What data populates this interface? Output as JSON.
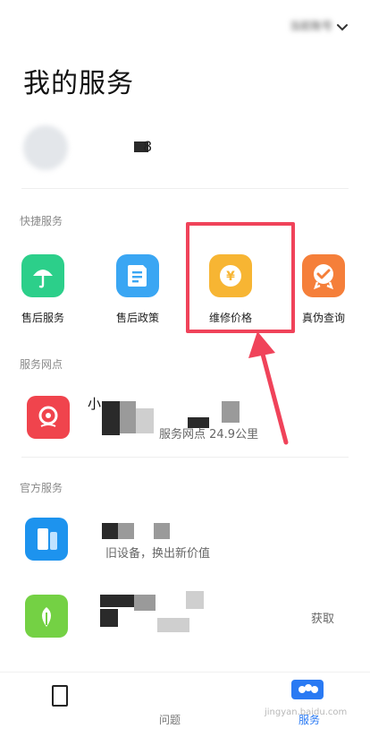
{
  "header": {
    "account_name": "当前账号",
    "title": "我的服务"
  },
  "user": {
    "name_fragment": "8"
  },
  "quick_services": {
    "label": "快捷服务",
    "items": [
      {
        "label": "售后服务",
        "color": "#2ccf8a",
        "icon": "umbrella-icon"
      },
      {
        "label": "售后政策",
        "color": "#3aa6f3",
        "icon": "document-icon"
      },
      {
        "label": "维修价格",
        "color": "#f7b533",
        "icon": "yen-coin-icon"
      },
      {
        "label": "真伪查询",
        "color": "#f57f3a",
        "icon": "badge-check-icon"
      }
    ]
  },
  "service_points": {
    "label": "服务网点",
    "item": {
      "title_fragment": "小",
      "distance_text": "服务网点 24.9公里",
      "color": "#f0444d"
    }
  },
  "official_services": {
    "label": "官方服务",
    "items": [
      {
        "subtitle": "旧设备，换出新价值",
        "color": "#1d93ee"
      },
      {
        "right_text": "获取",
        "color": "#74d144"
      }
    ]
  },
  "bottom_nav": {
    "items": [
      {
        "label": "问题",
        "active": false
      },
      {
        "label": "服务",
        "active": true
      }
    ],
    "accent": "#2a7af3"
  },
  "annotation": {
    "highlight_color": "#f0435a"
  },
  "watermark": "jingyan.baidu.com"
}
